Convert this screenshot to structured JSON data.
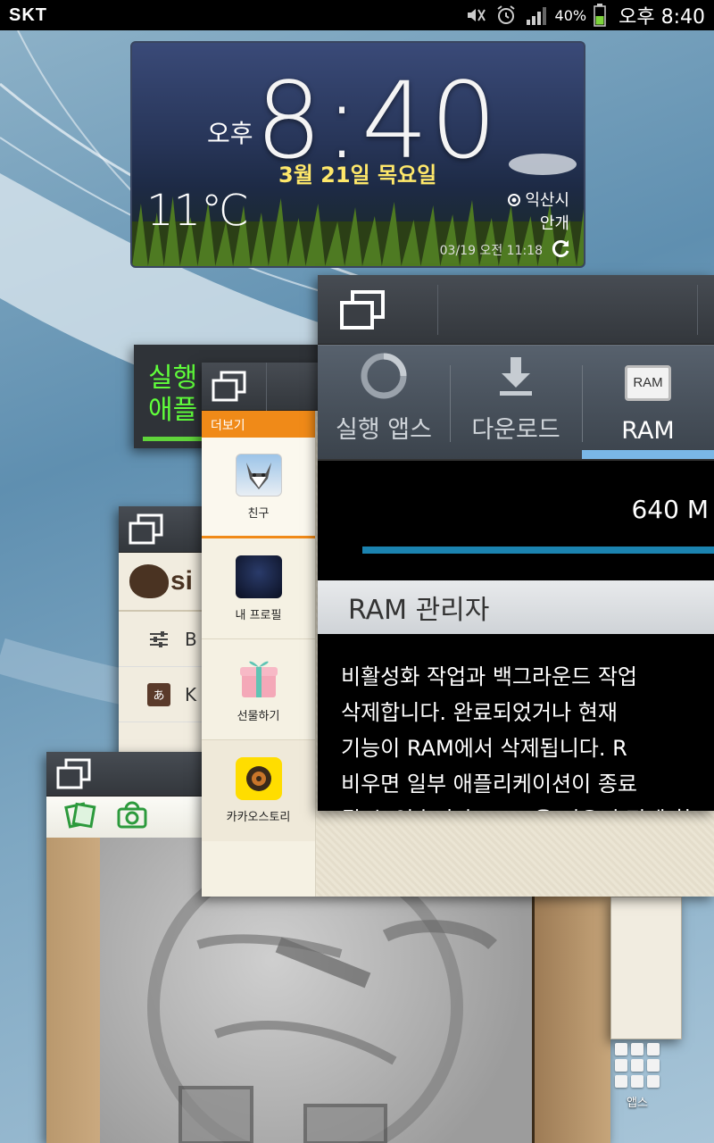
{
  "status_bar": {
    "carrier": "SKT",
    "battery_percent": "40%",
    "time": "오후 8:40",
    "icons": [
      "mute-icon",
      "alarm-icon",
      "signal-icon",
      "battery-icon"
    ]
  },
  "clock_widget": {
    "ampm": "오후",
    "time": "8:40",
    "date": "3월 21일 목요일",
    "temperature": "11℃",
    "city": "익산시",
    "weather": "안개",
    "updated": "03/19 오전 11:18"
  },
  "task_manager": {
    "tabs": [
      {
        "label": "실행 앱스",
        "icon": "ring-icon"
      },
      {
        "label": "다운로드",
        "icon": "download-icon"
      },
      {
        "label": "RAM",
        "icon": "ram-chip-icon",
        "chip_text": "RAM"
      }
    ],
    "ram_value": "640 M",
    "section_title": "RAM 관리자",
    "description_lines": [
      "비활성화 작업과 백그라운드 작업",
      "삭제합니다. 완료되었거나 현재",
      "기능이 RAM에서 삭제됩니다. R",
      "비우면 일부 애플리케이션이 종료",
      "될 수 있습니다. RAM을 비우기 전에 확"
    ]
  },
  "running_apps_card": {
    "line1": "실행",
    "line2": "애플"
  },
  "kakao_card": {
    "menu_title": "더보기",
    "items": [
      {
        "label": "친구",
        "icon": "husky-avatar-icon"
      },
      {
        "label": "내 프로필",
        "icon": "starry-profile-icon"
      },
      {
        "label": "선물하기",
        "icon": "gift-box-icon"
      },
      {
        "label": "카카오스토리",
        "icon": "kakaostory-icon"
      }
    ]
  },
  "sim_card": {
    "logo_text": "si",
    "rows": [
      {
        "text": "B",
        "icon": "sliders-icon"
      },
      {
        "text": "K",
        "icon": "language-icon"
      }
    ]
  },
  "paper_artist_card": {
    "toolbar_icons": [
      "photos-icon",
      "camera-icon"
    ]
  },
  "apps_launcher": {
    "label": "앱스"
  },
  "colors": {
    "running_green": "#60ff3b",
    "kakao_orange": "#f08a18",
    "ram_bar_blue": "#1b83b0",
    "date_yellow": "#ffe86a"
  }
}
